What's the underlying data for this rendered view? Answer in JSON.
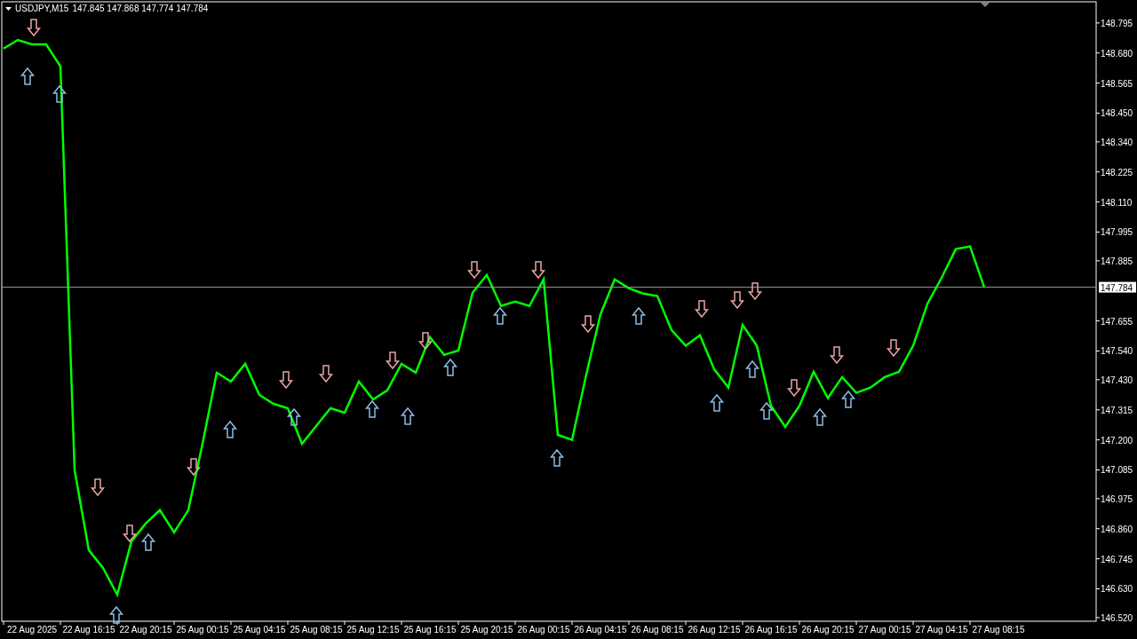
{
  "header": {
    "ohlc": "147.845 147.868 147.774 147.784"
  },
  "chart_data": {
    "type": "line",
    "ylim": [
      146.506,
      148.876
    ],
    "categories": [
      null,
      null,
      "22 Aug 2025",
      null,
      null,
      null,
      "22 Aug 16:15",
      null,
      null,
      null,
      "22 Aug 20:15",
      null,
      null,
      null,
      "25 Aug 00:15",
      null,
      null,
      null,
      "25 Aug 04:15",
      null,
      null,
      null,
      "25 Aug 08:15",
      null,
      null,
      null,
      "25 Aug 12:15",
      null,
      null,
      null,
      "25 Aug 16:15",
      null,
      null,
      null,
      "25 Aug 20:15",
      null,
      null,
      null,
      "26 Aug 00:15",
      null,
      null,
      null,
      "26 Aug 04:15",
      null,
      null,
      null,
      "26 Aug 08:15",
      null,
      null,
      null,
      "26 Aug 12:15",
      null,
      null,
      null,
      "26 Aug 16:15",
      null,
      null,
      null,
      "26 Aug 20:15",
      null,
      null,
      null,
      "27 Aug 00:15",
      null,
      null,
      null,
      "27 Aug 04:15",
      null,
      null,
      null,
      "27 Aug 08:15"
    ],
    "series": [
      {
        "name": "USDJPY,M15",
        "color": "#00ff00",
        "values": [
          148.697,
          148.73,
          148.713,
          148.713,
          148.629,
          147.084,
          146.778,
          146.71,
          146.608,
          146.812,
          146.88,
          146.931,
          146.846,
          146.931,
          147.185,
          147.457,
          147.423,
          147.491,
          147.372,
          147.338,
          147.321,
          147.185,
          147.253,
          147.321,
          147.304,
          147.423,
          147.355,
          147.389,
          147.491,
          147.457,
          147.593,
          147.525,
          147.542,
          147.763,
          147.831,
          147.712,
          147.729,
          147.712,
          147.814,
          147.219,
          147.2,
          147.45,
          147.68,
          147.814,
          147.78,
          147.76,
          147.75,
          147.62,
          147.56,
          147.6,
          147.47,
          147.4,
          147.64,
          147.56,
          147.33,
          147.25,
          147.33,
          147.46,
          147.36,
          147.44,
          147.38,
          147.4,
          147.44,
          147.46,
          147.56,
          147.72,
          147.82,
          147.93,
          147.94,
          147.784,
          null
        ]
      }
    ],
    "yticks": [
      {
        "value": 148.795,
        "label": "148.795"
      },
      {
        "value": 148.68,
        "label": "148.680"
      },
      {
        "value": 148.565,
        "label": "148.565"
      },
      {
        "value": 148.45,
        "label": "148.450"
      },
      {
        "value": 148.34,
        "label": "148.340"
      },
      {
        "value": 148.225,
        "label": "148.225"
      },
      {
        "value": 148.11,
        "label": "148.110"
      },
      {
        "value": 147.995,
        "label": "147.995"
      },
      {
        "value": 147.885,
        "label": "147.885"
      },
      {
        "value": 147.655,
        "label": "147.655"
      },
      {
        "value": 147.54,
        "label": "147.540"
      },
      {
        "value": 147.43,
        "label": "147.430"
      },
      {
        "value": 147.315,
        "label": "147.315"
      },
      {
        "value": 147.2,
        "label": "147.200"
      },
      {
        "value": 147.085,
        "label": "147.085"
      },
      {
        "value": 146.975,
        "label": "146.975"
      },
      {
        "value": 146.86,
        "label": "146.860"
      },
      {
        "value": 146.745,
        "label": "146.745"
      },
      {
        "value": 146.63,
        "label": "146.630"
      },
      {
        "value": 146.52,
        "label": "146.520"
      }
    ],
    "ref_lines": [
      {
        "axis": "y",
        "value": 147.784,
        "label": "147.784"
      }
    ]
  }
}
